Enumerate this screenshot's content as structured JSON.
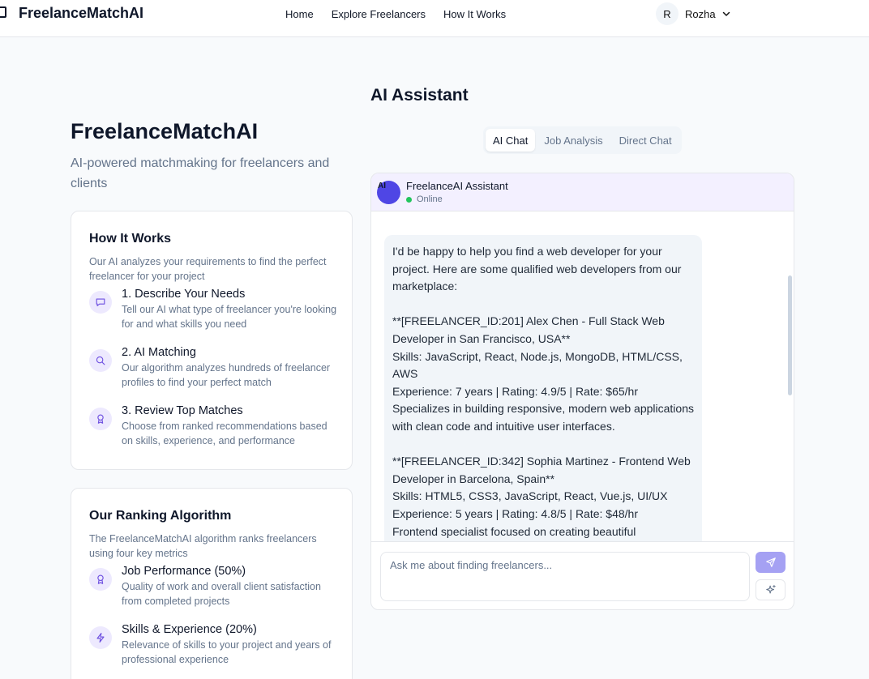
{
  "nav": {
    "brand": "FreelanceMatchAI",
    "links": [
      "Home",
      "Explore Freelancers",
      "How It Works"
    ],
    "user": {
      "initial": "R",
      "name": "Rozha"
    }
  },
  "hero": {
    "title": "FreelanceMatchAI",
    "subtitle": "AI-powered matchmaking for freelancers and clients"
  },
  "how_it_works": {
    "title": "How It Works",
    "description": "Our AI analyzes your requirements to find the perfect freelancer for your project",
    "steps": [
      {
        "icon": "message-square-icon",
        "title": "1. Describe Your Needs",
        "text": "Tell our AI what type of freelancer you're looking for and what skills you need"
      },
      {
        "icon": "search-icon",
        "title": "2. AI Matching",
        "text": "Our algorithm analyzes hundreds of freelancer profiles to find your perfect match"
      },
      {
        "icon": "award-icon",
        "title": "3. Review Top Matches",
        "text": "Choose from ranked recommendations based on skills, experience, and performance"
      }
    ]
  },
  "ranking": {
    "title": "Our Ranking Algorithm",
    "description": "The FreelanceMatchAI algorithm ranks freelancers using four key metrics",
    "metrics": [
      {
        "icon": "award-icon",
        "title": "Job Performance (50%)",
        "text": "Quality of work and overall client satisfaction from completed projects"
      },
      {
        "icon": "zap-icon",
        "title": "Skills & Experience (20%)",
        "text": "Relevance of skills to your project and years of professional experience"
      }
    ]
  },
  "assistant": {
    "title": "AI Assistant",
    "tabs": [
      "AI Chat",
      "Job Analysis",
      "Direct Chat"
    ],
    "active_tab": "AI Chat",
    "bot": {
      "avatar": "AI",
      "name": "FreelanceAI Assistant",
      "status": "Online"
    },
    "message": "I'd be happy to help you find a web developer for your project. Here are some qualified web developers from our marketplace:\n\n**[FREELANCER_ID:201] Alex Chen - Full Stack Web Developer in San Francisco, USA**\nSkills: JavaScript, React, Node.js, MongoDB, HTML/CSS, AWS\nExperience: 7 years | Rating: 4.9/5 | Rate: $65/hr\nSpecializes in building responsive, modern web applications with clean code and intuitive user interfaces.\n\n**[FREELANCER_ID:342] Sophia Martinez - Frontend Web Developer in Barcelona, Spain**\nSkills: HTML5, CSS3, JavaScript, React, Vue.js, UI/UX\nExperience: 5 years | Rating: 4.8/5 | Rate: $48/hr\nFrontend specialist focused on creating beautiful",
    "input_placeholder": "Ask me about finding freelancers...",
    "input_value": ""
  },
  "colors": {
    "accent": "#4f46e5",
    "accent_light": "#ede9fe",
    "send_button": "#a5a1f3",
    "online": "#22c55e"
  }
}
